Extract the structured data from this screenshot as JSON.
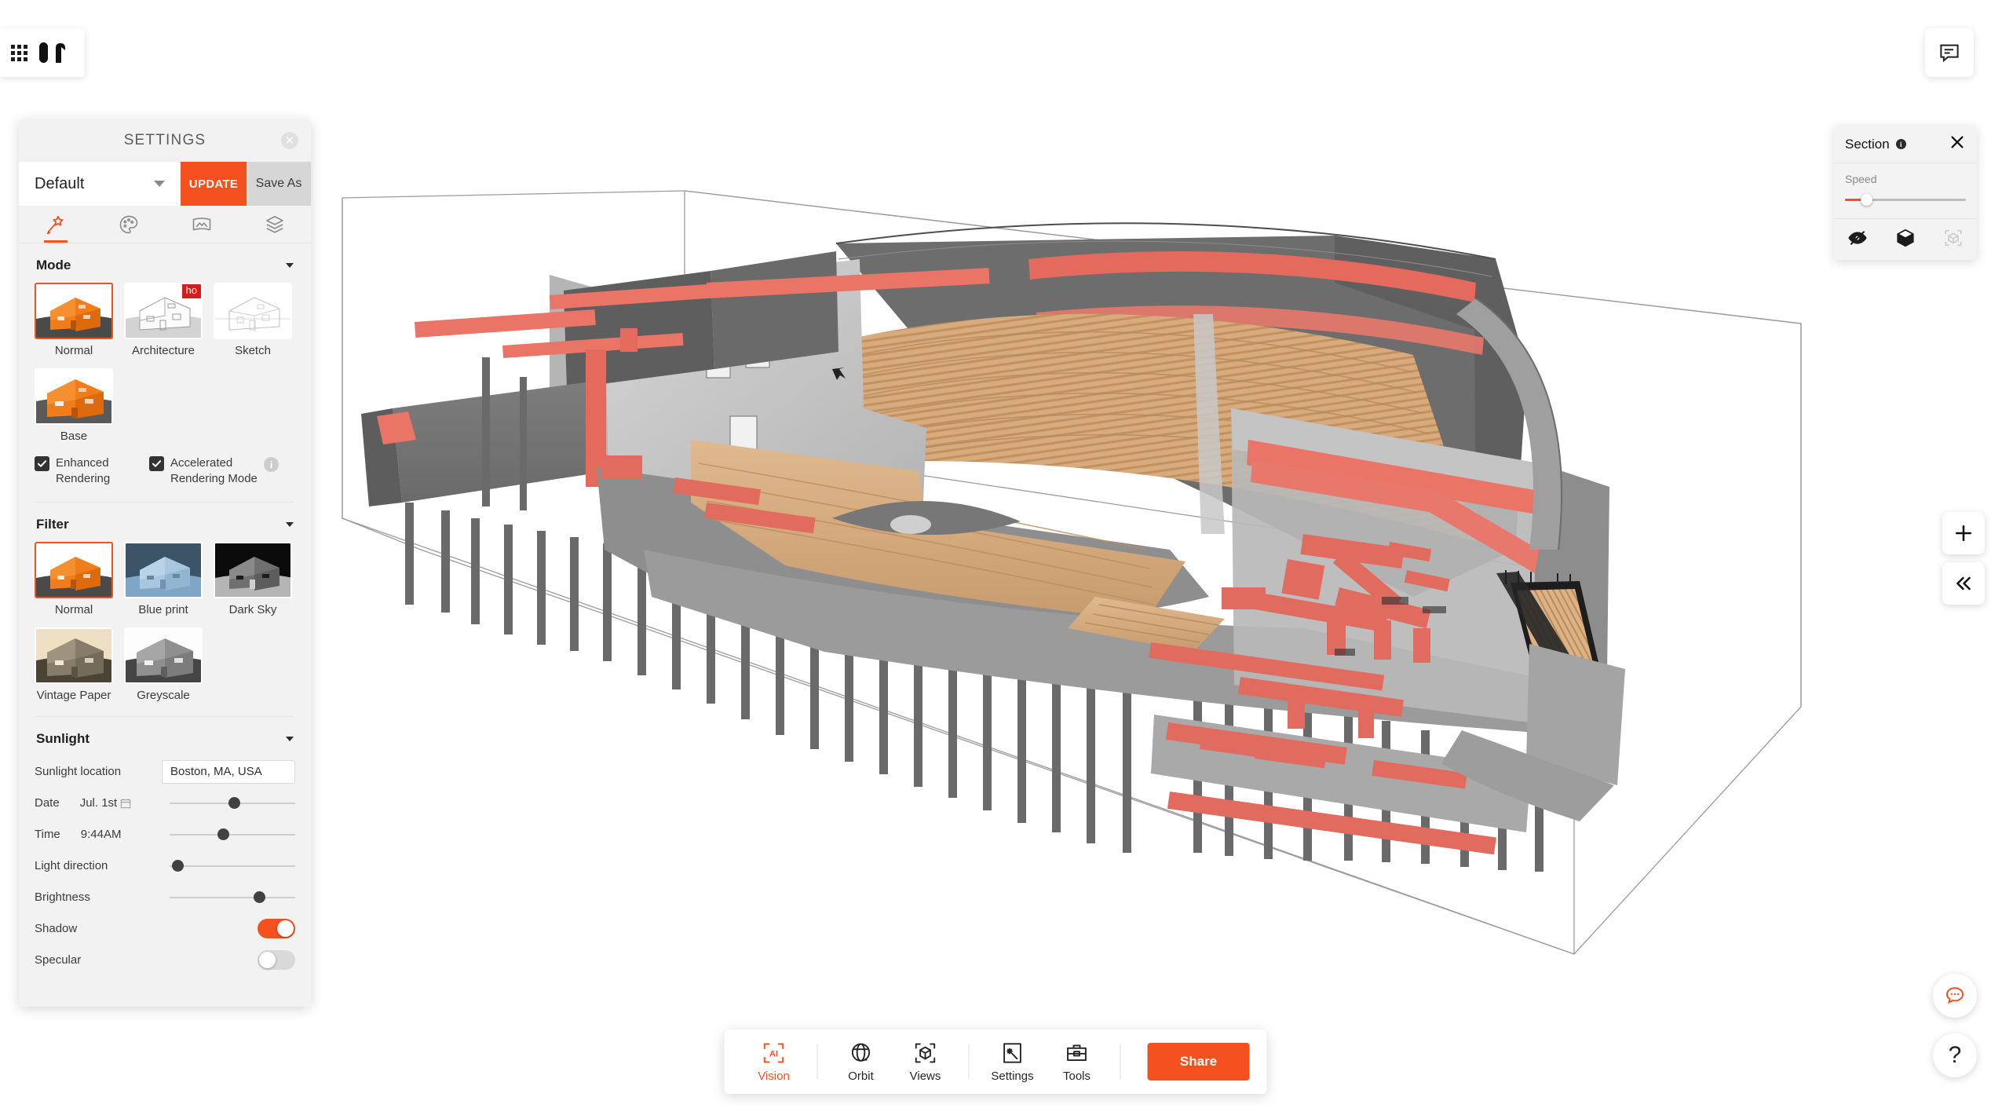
{
  "app": {
    "logo_icon": "grid-apps-icon",
    "brand_icon": "brand-mark-icon"
  },
  "topbar": {
    "chat_icon": "chat-bubble-icon"
  },
  "settings_panel": {
    "title": "SETTINGS",
    "close_icon": "close-icon",
    "preset": {
      "value": "Default",
      "caret_icon": "chevron-down-icon"
    },
    "update_label": "UPDATE",
    "save_as_label": "Save As",
    "tabs": [
      {
        "name": "magic-wand",
        "icon": "magic-wand-icon",
        "active": true
      },
      {
        "name": "palette",
        "icon": "palette-icon",
        "active": false
      },
      {
        "name": "image",
        "icon": "image-icon",
        "active": false
      },
      {
        "name": "layers",
        "icon": "layers-icon",
        "active": false
      }
    ],
    "mode": {
      "title": "Mode",
      "items": [
        {
          "label": "Normal",
          "selected": true,
          "badge": null
        },
        {
          "label": "Architecture",
          "selected": false,
          "badge": "ho"
        },
        {
          "label": "Sketch",
          "selected": false,
          "badge": null
        },
        {
          "label": "Base",
          "selected": false,
          "badge": null
        }
      ],
      "checkboxes": [
        {
          "label": "Enhanced Rendering",
          "checked": true
        },
        {
          "label": "Accelerated Rendering Mode",
          "checked": true
        }
      ],
      "info_icon": "info-icon"
    },
    "filter": {
      "title": "Filter",
      "items": [
        {
          "label": "Normal",
          "selected": true
        },
        {
          "label": "Blue print",
          "selected": false
        },
        {
          "label": "Dark Sky",
          "selected": false
        },
        {
          "label": "Vintage Paper",
          "selected": false
        },
        {
          "label": "Greyscale",
          "selected": false
        }
      ]
    },
    "sunlight": {
      "title": "Sunlight",
      "location_label": "Sunlight location",
      "location_value": "Boston, MA, USA",
      "date_label": "Date",
      "date_value": "Jul. 1st",
      "calendar_icon": "calendar-icon",
      "date_slider_pct": 47,
      "time_label": "Time",
      "time_value": "9:44AM",
      "time_slider_pct": 38,
      "light_direction_label": "Light direction",
      "light_direction_pct": 2,
      "brightness_label": "Brightness",
      "brightness_pct": 67,
      "shadow_label": "Shadow",
      "shadow_on": true,
      "specular_label": "Specular",
      "specular_on": false
    }
  },
  "section_panel": {
    "title": "Section",
    "info_icon": "info-icon",
    "close_icon": "close-icon",
    "speed_label": "Speed",
    "speed_pct": 14,
    "tools": [
      {
        "name": "eye-off-icon",
        "disabled": false
      },
      {
        "name": "cube-icon",
        "disabled": false
      },
      {
        "name": "isolate-icon",
        "disabled": true
      }
    ]
  },
  "viewport_controls": {
    "zoom_in_icon": "plus-icon",
    "collapse_icon": "chevrons-left-icon",
    "support_chat_icon": "chat-bubble-dots-icon",
    "help_icon": "question-mark-icon"
  },
  "bottom_toolbar": {
    "items": [
      {
        "label": "Vision",
        "icon": "ai-vision-icon",
        "accent": true
      },
      {
        "label": "Orbit",
        "icon": "orbit-icon",
        "accent": false
      },
      {
        "label": "Views",
        "icon": "views-cube-icon",
        "accent": false
      },
      {
        "label": "Settings",
        "icon": "settings-wand-icon",
        "accent": false
      },
      {
        "label": "Tools",
        "icon": "toolbox-icon",
        "accent": false
      }
    ],
    "share_label": "Share"
  },
  "colors": {
    "accent": "#f4511e",
    "panel_bg": "#f2f2f2",
    "badge_red": "#d61b1b",
    "model_highlight": "#e8776b",
    "model_wood": "#d9b184",
    "model_grey": "#9a9a9a"
  },
  "model": {
    "name": "theater-auditorium-section-3d-model",
    "description": "3D sectioned BIM model of an auditorium with tiered wooden seating, concrete structure, red MEP ducts and piers"
  }
}
